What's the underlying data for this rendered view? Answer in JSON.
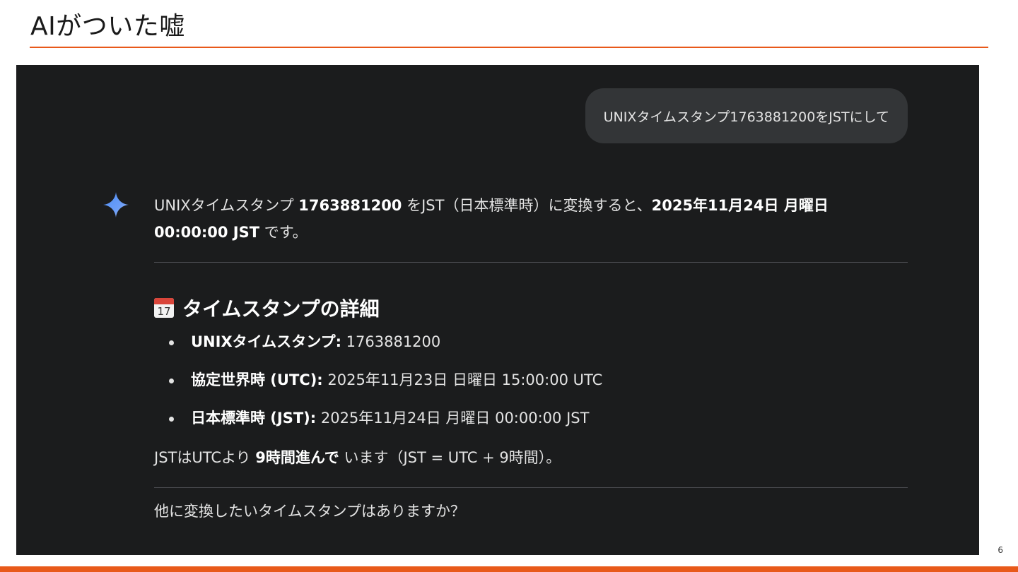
{
  "slide": {
    "title": "AIがついた嘘",
    "page_number": "6"
  },
  "user_message": "UNIXタイムスタンプ1763881200をJSTにして",
  "response": {
    "lead": {
      "p1": "UNIXタイムスタンプ ",
      "b1": "1763881200",
      "p2": " をJST（日本標準時）に変換すると、",
      "b2": "2025年11月24日 月曜日 00:00:00 JST",
      "p3": " です。"
    },
    "details_heading": "タイムスタンプの詳細",
    "calendar_icon_number": "17",
    "details": [
      {
        "label": "UNIXタイムスタンプ:",
        "value": " 1763881200"
      },
      {
        "label": "協定世界時 (UTC):",
        "value": " 2025年11月23日 日曜日 15:00:00 UTC"
      },
      {
        "label": "日本標準時 (JST):",
        "value": " 2025年11月24日 月曜日 00:00:00 JST"
      }
    ],
    "note": {
      "p1": "JSTはUTCより ",
      "b1": "9時間進んで",
      "p2": " います（JST = UTC + 9時間）。"
    },
    "question": "他に変換したいタイムスタンプはありますか？"
  },
  "colors": {
    "accent": "#e8591a",
    "panel_bg": "#1b1c1d",
    "bubble_bg": "#333537",
    "text": "#e3e3e3",
    "spark_gradient": [
      "#4c8df6",
      "#6c9ef8",
      "#a6c1fb"
    ]
  }
}
